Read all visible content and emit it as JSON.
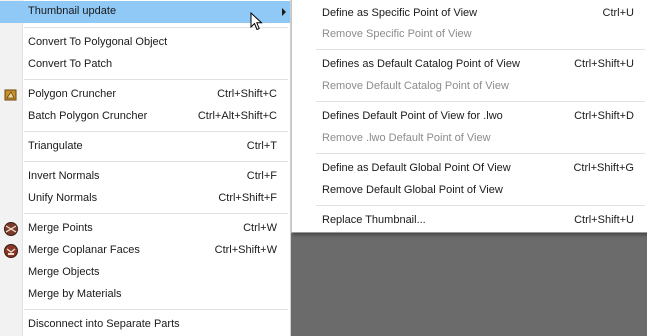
{
  "main_menu": {
    "items": [
      {
        "label": "Thumbnail update",
        "shortcut": ""
      },
      {
        "label": "Convert To Polygonal Object",
        "shortcut": ""
      },
      {
        "label": "Convert To Patch",
        "shortcut": ""
      },
      {
        "label": "Polygon Cruncher",
        "shortcut": "Ctrl+Shift+C",
        "icon": "polygon-cruncher-icon"
      },
      {
        "label": "Batch Polygon Cruncher",
        "shortcut": "Ctrl+Alt+Shift+C"
      },
      {
        "label": "Triangulate",
        "shortcut": "Ctrl+T"
      },
      {
        "label": "Invert Normals",
        "shortcut": "Ctrl+F"
      },
      {
        "label": "Unify Normals",
        "shortcut": "Ctrl+Shift+F"
      },
      {
        "label": "Merge Points",
        "shortcut": "Ctrl+W",
        "icon": "merge-points-icon"
      },
      {
        "label": "Merge Coplanar Faces",
        "shortcut": "Ctrl+Shift+W",
        "icon": "merge-coplanar-faces-icon"
      },
      {
        "label": "Merge Objects",
        "shortcut": ""
      },
      {
        "label": "Merge by Materials",
        "shortcut": ""
      },
      {
        "label": "Disconnect into Separate Parts",
        "shortcut": ""
      }
    ]
  },
  "sub_menu": {
    "items": [
      {
        "label": "Define as Specific Point of View",
        "shortcut": "Ctrl+U"
      },
      {
        "label": "Remove Specific Point of View",
        "shortcut": ""
      },
      {
        "label": "Defines as Default Catalog Point of View",
        "shortcut": "Ctrl+Shift+U"
      },
      {
        "label": "Remove Default Catalog Point of View",
        "shortcut": ""
      },
      {
        "label": "Defines Default Point of View for .lwo",
        "shortcut": "Ctrl+Shift+D"
      },
      {
        "label": "Remove .lwo Default Point of View",
        "shortcut": ""
      },
      {
        "label": "Define as Default Global Point Of View",
        "shortcut": "Ctrl+Shift+G"
      },
      {
        "label": "Remove Default Global Point of View",
        "shortcut": ""
      },
      {
        "label": "Replace Thumbnail...",
        "shortcut": "Ctrl+Shift+U"
      }
    ]
  },
  "colors": {
    "highlight": "#90c8f6",
    "disabled_text": "#8c8c8c",
    "background_area": "#6b6b6b"
  },
  "icons": [
    "submenu-arrow-icon",
    "mouse-cursor-icon",
    "polygon-cruncher-icon",
    "merge-points-icon",
    "merge-coplanar-faces-icon"
  ]
}
